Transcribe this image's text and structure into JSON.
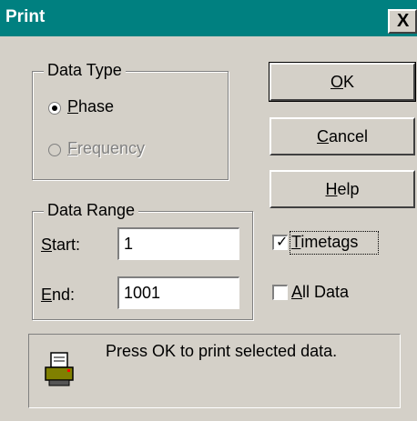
{
  "window": {
    "title": "Print",
    "close_glyph": "X"
  },
  "data_type": {
    "legend": "Data Type",
    "phase": {
      "label_hotkey": "P",
      "label_rest": "hase",
      "selected": true
    },
    "frequency": {
      "label_hotkey": "F",
      "label_rest": "requency",
      "disabled": true
    }
  },
  "data_range": {
    "legend": "Data Range",
    "start": {
      "label_hotkey": "S",
      "label_rest": "tart:",
      "value": "1"
    },
    "end": {
      "label_hotkey": "E",
      "label_rest": "nd:",
      "value": "1001"
    }
  },
  "buttons": {
    "ok": {
      "hotkey": "O",
      "rest": "K"
    },
    "cancel": {
      "hotkey": "C",
      "rest": "ancel"
    },
    "help": {
      "hotkey": "H",
      "rest": "elp"
    }
  },
  "options": {
    "timetags": {
      "hotkey": "T",
      "rest": "imetags",
      "checked": true
    },
    "all_data": {
      "hotkey": "A",
      "rest": "ll Data",
      "checked": false
    }
  },
  "status": {
    "message": "Press OK to print selected data.",
    "icon": "printer-icon"
  }
}
